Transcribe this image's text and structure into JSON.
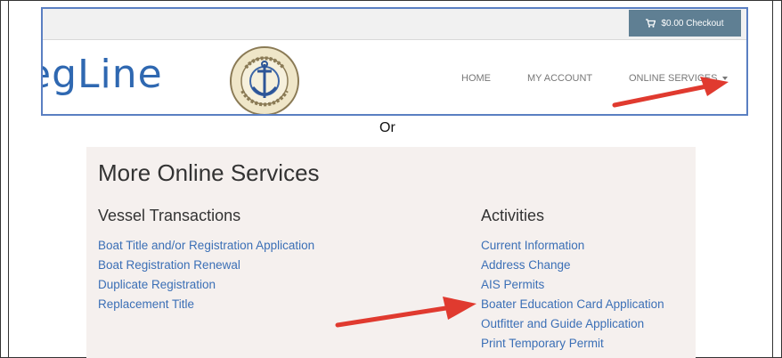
{
  "header": {
    "cart_label": "$0.00 Checkout",
    "logo_text": "egLine",
    "nav": [
      {
        "label": "HOME"
      },
      {
        "label": "MY ACCOUNT"
      },
      {
        "label": "ONLINE SERVICES"
      }
    ]
  },
  "separator_text": "Or",
  "services": {
    "title": "More Online Services",
    "vessel": {
      "heading": "Vessel Transactions",
      "links": [
        "Boat Title and/or Registration Application",
        "Boat Registration Renewal",
        "Duplicate Registration",
        "Replacement Title"
      ]
    },
    "activities": {
      "heading": "Activities",
      "links": [
        "Current Information",
        "Address Change",
        "AIS Permits",
        "Boater Education Card Application",
        "Outfitter and Guide Application",
        "Print Temporary Permit"
      ]
    }
  },
  "colors": {
    "link": "#3b6fb6",
    "cart_button": "#5f7f93",
    "logo": "#2f68b1",
    "arrow": "#e03a2f",
    "panel_bg": "#f5f0ee"
  },
  "icons": [
    "cart-icon",
    "caret-down-icon",
    "state-marine-board-seal",
    "red-arrow"
  ]
}
